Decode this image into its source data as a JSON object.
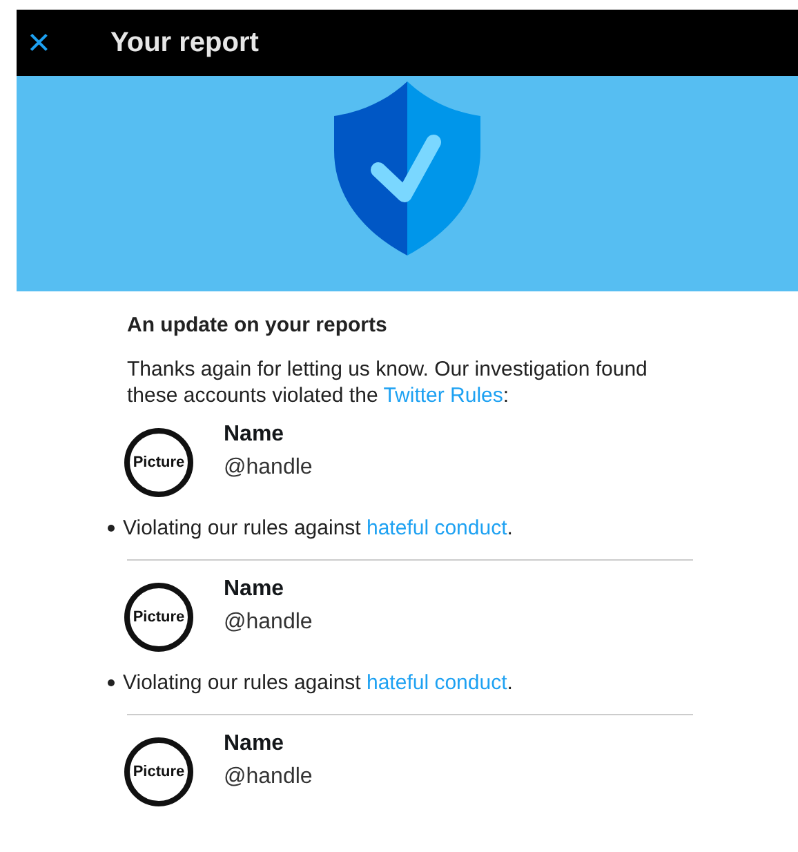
{
  "header": {
    "close_icon": "×",
    "title": "Your report"
  },
  "update": {
    "heading": "An update on your reports",
    "intro": "Thanks again for letting us know. Our investigation found these accounts violated the ",
    "intro_link": "Twitter Rules",
    "intro_end": ":"
  },
  "accounts": [
    {
      "avatar_label": "Picture",
      "name": "Name",
      "handle": "@handle",
      "violation": {
        "text": "Violating our rules against ",
        "link": "hateful conduct",
        "end": "."
      }
    },
    {
      "avatar_label": "Picture",
      "name": "Name",
      "handle": "@handle",
      "violation": {
        "text": "Violating our rules against ",
        "link": "hateful conduct",
        "end": "."
      }
    },
    {
      "avatar_label": "Picture",
      "name": "Name",
      "handle": "@handle"
    }
  ]
}
